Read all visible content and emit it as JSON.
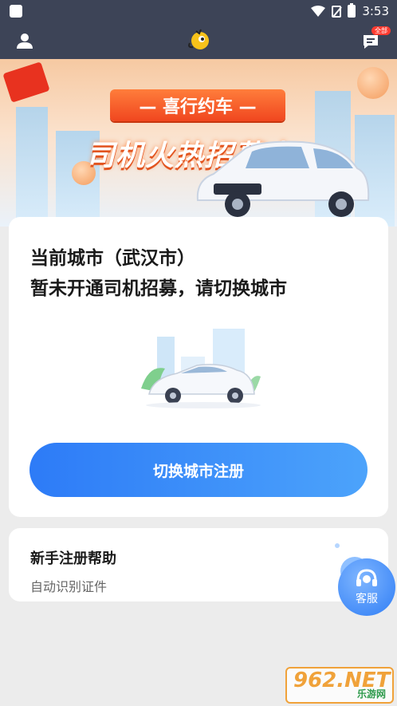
{
  "status_bar": {
    "time": "3:53"
  },
  "app_bar": {
    "message_badge": "全部"
  },
  "banner": {
    "ribbon_text": "— 喜行约车 —",
    "title": "司机火热招募中"
  },
  "main_card": {
    "city_line": "当前城市（武汉市）",
    "message_line": "暂未开通司机招募，请切换城市",
    "switch_button": "切换城市注册"
  },
  "help_card": {
    "title": "新手注册帮助",
    "subtitle": "自动识别证件"
  },
  "service_button": {
    "label": "客服"
  },
  "watermark": {
    "text": "962.NET",
    "sub": "乐游网"
  },
  "colors": {
    "header": "#3d4457",
    "accent_blue": "#2d7bf7",
    "banner_orange": "#f0461f"
  },
  "icons": [
    "wifi-icon",
    "sim-icon",
    "battery-icon",
    "user-icon",
    "logo-icon",
    "message-icon",
    "headset-icon"
  ]
}
